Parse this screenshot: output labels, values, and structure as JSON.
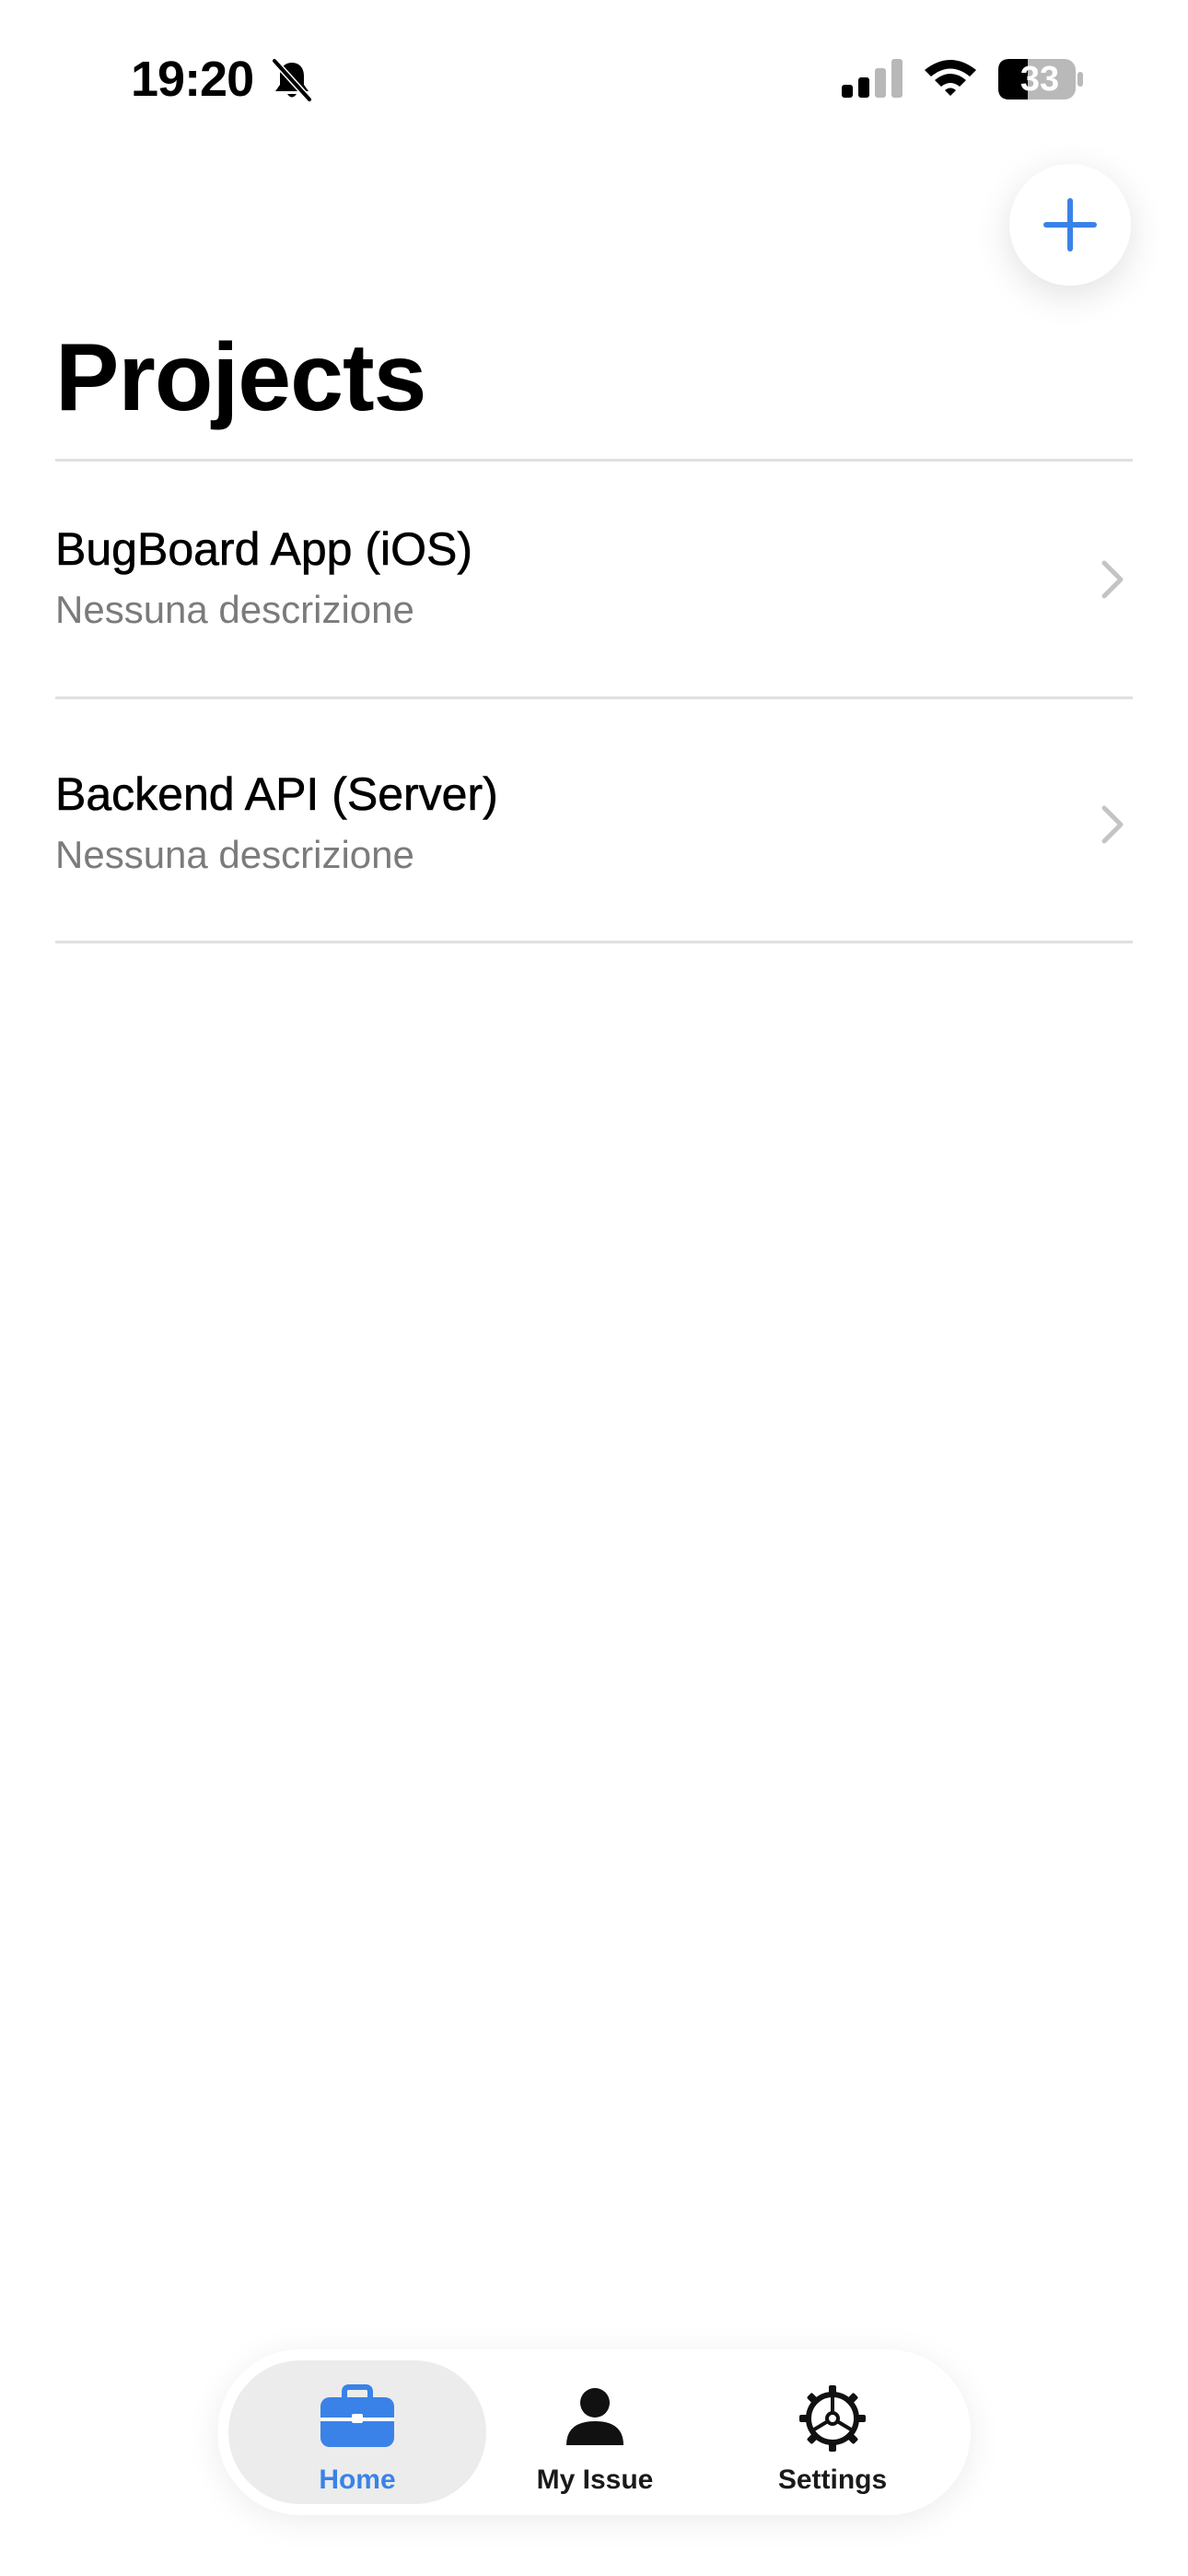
{
  "status_bar": {
    "time": "19:20",
    "battery": "33",
    "icons": [
      "bell-slash-icon",
      "cellular-signal-icon",
      "wifi-icon",
      "battery-icon"
    ]
  },
  "header": {
    "add_icon": "plus-icon",
    "title": "Projects"
  },
  "projects": [
    {
      "name": "BugBoard App (iOS)",
      "description": "Nessuna descrizione"
    },
    {
      "name": "Backend API (Server)",
      "description": "Nessuna descrizione"
    }
  ],
  "tabbar": {
    "tabs": [
      {
        "label": "Home",
        "icon": "briefcase-icon",
        "active": true
      },
      {
        "label": "My Issue",
        "icon": "person-icon",
        "active": false
      },
      {
        "label": "Settings",
        "icon": "gear-icon",
        "active": false
      }
    ]
  },
  "colors": {
    "accent": "#3a82e8",
    "secondary_text": "#7b7b7b",
    "divider": "#e0e0e0"
  }
}
